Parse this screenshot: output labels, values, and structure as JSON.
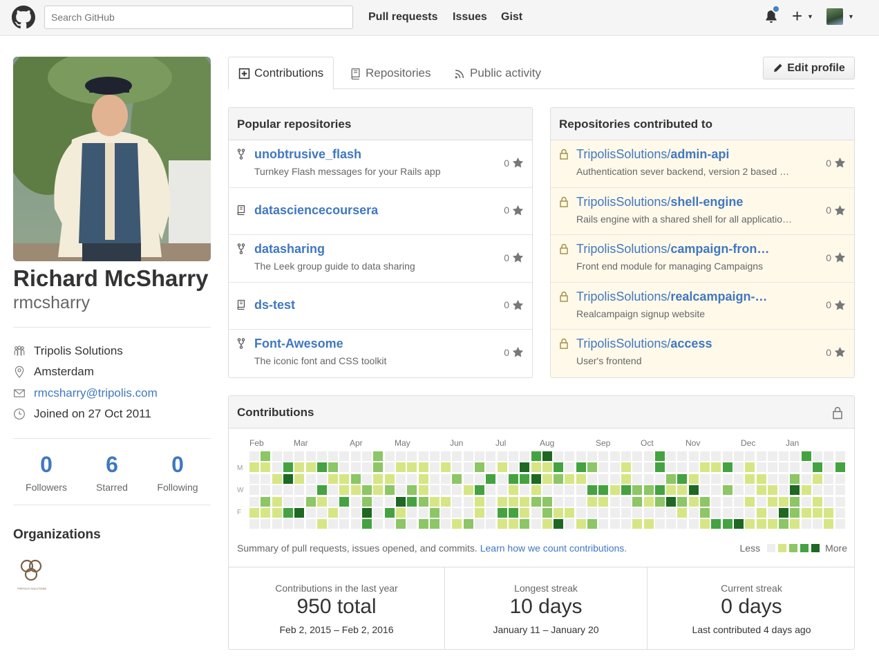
{
  "header": {
    "search_placeholder": "Search GitHub",
    "nav": [
      "Pull requests",
      "Issues",
      "Gist"
    ]
  },
  "profile": {
    "full_name": "Richard McSharry",
    "username": "rmcsharry",
    "company": "Tripolis Solutions",
    "location": "Amsterdam",
    "email": "rmcsharry@tripolis.com",
    "joined": "Joined on 27 Oct 2011",
    "stats": [
      {
        "num": "0",
        "label": "Followers"
      },
      {
        "num": "6",
        "label": "Starred"
      },
      {
        "num": "0",
        "label": "Following"
      }
    ],
    "orgs_title": "Organizations",
    "org_logo_text": "TRIPOLIS SOLUTIONS"
  },
  "tabs": {
    "contributions": "Contributions",
    "repositories": "Repositories",
    "activity": "Public activity",
    "edit_profile": "Edit profile"
  },
  "popular": {
    "title": "Popular repositories",
    "repos": [
      {
        "name": "unobtrusive_flash",
        "desc": "Turnkey Flash messages for your Rails app",
        "stars": "0",
        "icon": "fork-icon"
      },
      {
        "name": "datasciencecoursera",
        "desc": "",
        "stars": "0",
        "icon": "book-icon"
      },
      {
        "name": "datasharing",
        "desc": "The Leek group guide to data sharing",
        "stars": "0",
        "icon": "fork-icon"
      },
      {
        "name": "ds-test",
        "desc": "",
        "stars": "0",
        "icon": "book-icon"
      },
      {
        "name": "Font-Awesome",
        "desc": "The iconic font and CSS toolkit",
        "stars": "0",
        "icon": "fork-icon"
      }
    ]
  },
  "contributed": {
    "title": "Repositories contributed to",
    "repos": [
      {
        "owner": "TripolisSolutions/",
        "name": "admin-api",
        "desc": "Authentication sever backend, version 2 based …",
        "stars": "0"
      },
      {
        "owner": "TripolisSolutions/",
        "name": "shell-engine",
        "desc": "Rails engine with a shared shell for all applicatio…",
        "stars": "0"
      },
      {
        "owner": "TripolisSolutions/",
        "name": "campaign-fron…",
        "desc": "Front end module for managing Campaigns",
        "stars": "0"
      },
      {
        "owner": "TripolisSolutions/",
        "name": "realcampaign-…",
        "desc": "Realcampaign signup website",
        "stars": "0"
      },
      {
        "owner": "TripolisSolutions/",
        "name": "access",
        "desc": "User's frontend",
        "stars": "0"
      }
    ]
  },
  "contributions": {
    "title": "Contributions",
    "months": [
      "Feb",
      "Mar",
      "Apr",
      "May",
      "Jun",
      "Jul",
      "Aug",
      "Sep",
      "Oct",
      "Nov",
      "Dec",
      "Jan"
    ],
    "day_labels": [
      "M",
      "W",
      "F"
    ],
    "summary": "Summary of pull requests, issues opened, and commits.",
    "learn_link": "Learn how we count contributions.",
    "less": "Less",
    "more": "More",
    "colors": [
      "#eeeeee",
      "#d6e685",
      "#8cc665",
      "#44a340",
      "#1e6823"
    ],
    "streaks": [
      {
        "title": "Contributions in the last year",
        "value": "950 total",
        "range": "Feb 2, 2015 – Feb 2, 2016"
      },
      {
        "title": "Longest streak",
        "value": "10 days",
        "range": "January 11 – January 20"
      },
      {
        "title": "Current streak",
        "value": "0 days",
        "range": "Last contributed 4 days ago"
      }
    ]
  }
}
